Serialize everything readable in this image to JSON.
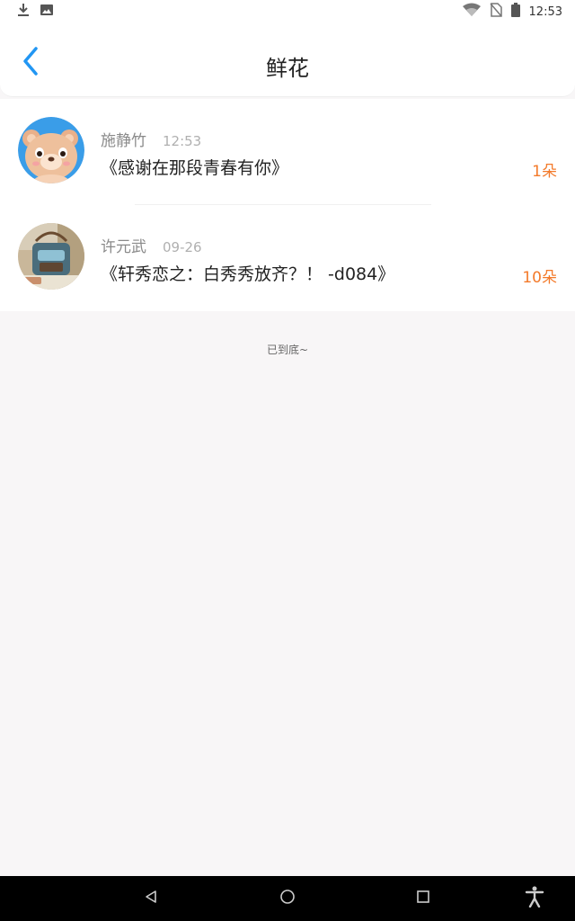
{
  "status_bar": {
    "time": "12:53",
    "icons": [
      "download-icon",
      "image-icon",
      "wifi-icon",
      "no-sim-icon",
      "battery-icon"
    ]
  },
  "header": {
    "title": "鲜花",
    "back_icon": "back-arrow-icon"
  },
  "items": [
    {
      "name": "施静竹",
      "time": "12:53",
      "title": "《感谢在那段青春有你》",
      "count": "1朵",
      "avatar": "bear-avatar"
    },
    {
      "name": "许元武",
      "time": "09-26",
      "title": "《轩秀恋之：白秀秀放齐？！ -d084》",
      "count": "10朵",
      "avatar": "photo-avatar"
    }
  ],
  "end_note": "已到底~",
  "colors": {
    "accent": "#2196f3",
    "count": "#f37a2a",
    "background": "#f8f6f7"
  },
  "nav_bar": {
    "icons": [
      "back-triangle-icon",
      "home-circle-icon",
      "recents-square-icon",
      "accessibility-icon"
    ]
  }
}
